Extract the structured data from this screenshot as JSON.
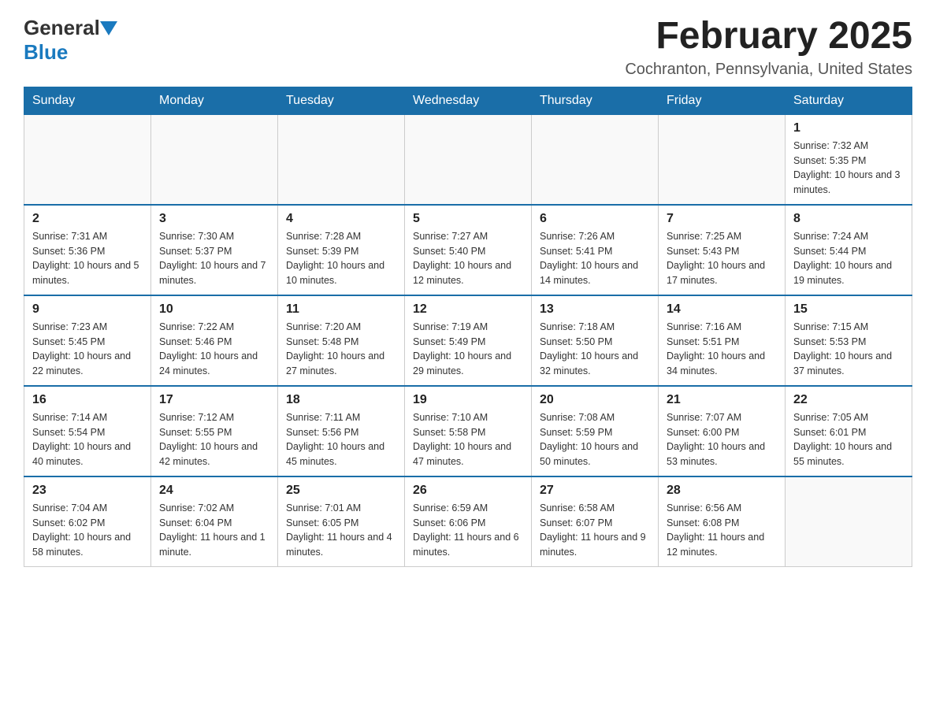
{
  "header": {
    "logo_general": "General",
    "logo_blue": "Blue",
    "month_title": "February 2025",
    "location": "Cochranton, Pennsylvania, United States"
  },
  "days_of_week": [
    "Sunday",
    "Monday",
    "Tuesday",
    "Wednesday",
    "Thursday",
    "Friday",
    "Saturday"
  ],
  "weeks": [
    [
      {
        "day": "",
        "info": ""
      },
      {
        "day": "",
        "info": ""
      },
      {
        "day": "",
        "info": ""
      },
      {
        "day": "",
        "info": ""
      },
      {
        "day": "",
        "info": ""
      },
      {
        "day": "",
        "info": ""
      },
      {
        "day": "1",
        "info": "Sunrise: 7:32 AM\nSunset: 5:35 PM\nDaylight: 10 hours and 3 minutes."
      }
    ],
    [
      {
        "day": "2",
        "info": "Sunrise: 7:31 AM\nSunset: 5:36 PM\nDaylight: 10 hours and 5 minutes."
      },
      {
        "day": "3",
        "info": "Sunrise: 7:30 AM\nSunset: 5:37 PM\nDaylight: 10 hours and 7 minutes."
      },
      {
        "day": "4",
        "info": "Sunrise: 7:28 AM\nSunset: 5:39 PM\nDaylight: 10 hours and 10 minutes."
      },
      {
        "day": "5",
        "info": "Sunrise: 7:27 AM\nSunset: 5:40 PM\nDaylight: 10 hours and 12 minutes."
      },
      {
        "day": "6",
        "info": "Sunrise: 7:26 AM\nSunset: 5:41 PM\nDaylight: 10 hours and 14 minutes."
      },
      {
        "day": "7",
        "info": "Sunrise: 7:25 AM\nSunset: 5:43 PM\nDaylight: 10 hours and 17 minutes."
      },
      {
        "day": "8",
        "info": "Sunrise: 7:24 AM\nSunset: 5:44 PM\nDaylight: 10 hours and 19 minutes."
      }
    ],
    [
      {
        "day": "9",
        "info": "Sunrise: 7:23 AM\nSunset: 5:45 PM\nDaylight: 10 hours and 22 minutes."
      },
      {
        "day": "10",
        "info": "Sunrise: 7:22 AM\nSunset: 5:46 PM\nDaylight: 10 hours and 24 minutes."
      },
      {
        "day": "11",
        "info": "Sunrise: 7:20 AM\nSunset: 5:48 PM\nDaylight: 10 hours and 27 minutes."
      },
      {
        "day": "12",
        "info": "Sunrise: 7:19 AM\nSunset: 5:49 PM\nDaylight: 10 hours and 29 minutes."
      },
      {
        "day": "13",
        "info": "Sunrise: 7:18 AM\nSunset: 5:50 PM\nDaylight: 10 hours and 32 minutes."
      },
      {
        "day": "14",
        "info": "Sunrise: 7:16 AM\nSunset: 5:51 PM\nDaylight: 10 hours and 34 minutes."
      },
      {
        "day": "15",
        "info": "Sunrise: 7:15 AM\nSunset: 5:53 PM\nDaylight: 10 hours and 37 minutes."
      }
    ],
    [
      {
        "day": "16",
        "info": "Sunrise: 7:14 AM\nSunset: 5:54 PM\nDaylight: 10 hours and 40 minutes."
      },
      {
        "day": "17",
        "info": "Sunrise: 7:12 AM\nSunset: 5:55 PM\nDaylight: 10 hours and 42 minutes."
      },
      {
        "day": "18",
        "info": "Sunrise: 7:11 AM\nSunset: 5:56 PM\nDaylight: 10 hours and 45 minutes."
      },
      {
        "day": "19",
        "info": "Sunrise: 7:10 AM\nSunset: 5:58 PM\nDaylight: 10 hours and 47 minutes."
      },
      {
        "day": "20",
        "info": "Sunrise: 7:08 AM\nSunset: 5:59 PM\nDaylight: 10 hours and 50 minutes."
      },
      {
        "day": "21",
        "info": "Sunrise: 7:07 AM\nSunset: 6:00 PM\nDaylight: 10 hours and 53 minutes."
      },
      {
        "day": "22",
        "info": "Sunrise: 7:05 AM\nSunset: 6:01 PM\nDaylight: 10 hours and 55 minutes."
      }
    ],
    [
      {
        "day": "23",
        "info": "Sunrise: 7:04 AM\nSunset: 6:02 PM\nDaylight: 10 hours and 58 minutes."
      },
      {
        "day": "24",
        "info": "Sunrise: 7:02 AM\nSunset: 6:04 PM\nDaylight: 11 hours and 1 minute."
      },
      {
        "day": "25",
        "info": "Sunrise: 7:01 AM\nSunset: 6:05 PM\nDaylight: 11 hours and 4 minutes."
      },
      {
        "day": "26",
        "info": "Sunrise: 6:59 AM\nSunset: 6:06 PM\nDaylight: 11 hours and 6 minutes."
      },
      {
        "day": "27",
        "info": "Sunrise: 6:58 AM\nSunset: 6:07 PM\nDaylight: 11 hours and 9 minutes."
      },
      {
        "day": "28",
        "info": "Sunrise: 6:56 AM\nSunset: 6:08 PM\nDaylight: 11 hours and 12 minutes."
      },
      {
        "day": "",
        "info": ""
      }
    ]
  ]
}
